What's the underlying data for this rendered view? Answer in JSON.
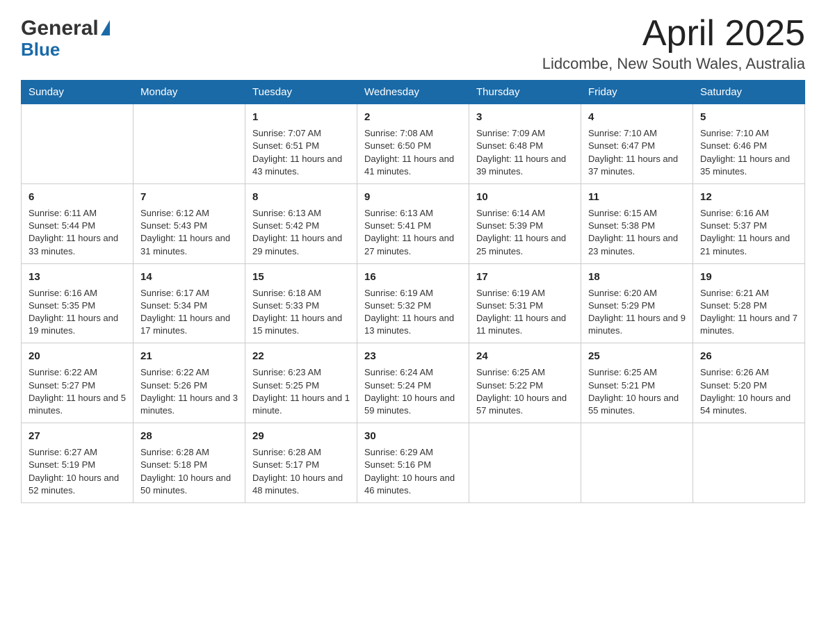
{
  "header": {
    "logo_line1": "General",
    "logo_line2": "Blue",
    "month_year": "April 2025",
    "location": "Lidcombe, New South Wales, Australia"
  },
  "weekdays": [
    "Sunday",
    "Monday",
    "Tuesday",
    "Wednesday",
    "Thursday",
    "Friday",
    "Saturday"
  ],
  "weeks": [
    [
      {
        "day": "",
        "sunrise": "",
        "sunset": "",
        "daylight": ""
      },
      {
        "day": "",
        "sunrise": "",
        "sunset": "",
        "daylight": ""
      },
      {
        "day": "1",
        "sunrise": "Sunrise: 7:07 AM",
        "sunset": "Sunset: 6:51 PM",
        "daylight": "Daylight: 11 hours and 43 minutes."
      },
      {
        "day": "2",
        "sunrise": "Sunrise: 7:08 AM",
        "sunset": "Sunset: 6:50 PM",
        "daylight": "Daylight: 11 hours and 41 minutes."
      },
      {
        "day": "3",
        "sunrise": "Sunrise: 7:09 AM",
        "sunset": "Sunset: 6:48 PM",
        "daylight": "Daylight: 11 hours and 39 minutes."
      },
      {
        "day": "4",
        "sunrise": "Sunrise: 7:10 AM",
        "sunset": "Sunset: 6:47 PM",
        "daylight": "Daylight: 11 hours and 37 minutes."
      },
      {
        "day": "5",
        "sunrise": "Sunrise: 7:10 AM",
        "sunset": "Sunset: 6:46 PM",
        "daylight": "Daylight: 11 hours and 35 minutes."
      }
    ],
    [
      {
        "day": "6",
        "sunrise": "Sunrise: 6:11 AM",
        "sunset": "Sunset: 5:44 PM",
        "daylight": "Daylight: 11 hours and 33 minutes."
      },
      {
        "day": "7",
        "sunrise": "Sunrise: 6:12 AM",
        "sunset": "Sunset: 5:43 PM",
        "daylight": "Daylight: 11 hours and 31 minutes."
      },
      {
        "day": "8",
        "sunrise": "Sunrise: 6:13 AM",
        "sunset": "Sunset: 5:42 PM",
        "daylight": "Daylight: 11 hours and 29 minutes."
      },
      {
        "day": "9",
        "sunrise": "Sunrise: 6:13 AM",
        "sunset": "Sunset: 5:41 PM",
        "daylight": "Daylight: 11 hours and 27 minutes."
      },
      {
        "day": "10",
        "sunrise": "Sunrise: 6:14 AM",
        "sunset": "Sunset: 5:39 PM",
        "daylight": "Daylight: 11 hours and 25 minutes."
      },
      {
        "day": "11",
        "sunrise": "Sunrise: 6:15 AM",
        "sunset": "Sunset: 5:38 PM",
        "daylight": "Daylight: 11 hours and 23 minutes."
      },
      {
        "day": "12",
        "sunrise": "Sunrise: 6:16 AM",
        "sunset": "Sunset: 5:37 PM",
        "daylight": "Daylight: 11 hours and 21 minutes."
      }
    ],
    [
      {
        "day": "13",
        "sunrise": "Sunrise: 6:16 AM",
        "sunset": "Sunset: 5:35 PM",
        "daylight": "Daylight: 11 hours and 19 minutes."
      },
      {
        "day": "14",
        "sunrise": "Sunrise: 6:17 AM",
        "sunset": "Sunset: 5:34 PM",
        "daylight": "Daylight: 11 hours and 17 minutes."
      },
      {
        "day": "15",
        "sunrise": "Sunrise: 6:18 AM",
        "sunset": "Sunset: 5:33 PM",
        "daylight": "Daylight: 11 hours and 15 minutes."
      },
      {
        "day": "16",
        "sunrise": "Sunrise: 6:19 AM",
        "sunset": "Sunset: 5:32 PM",
        "daylight": "Daylight: 11 hours and 13 minutes."
      },
      {
        "day": "17",
        "sunrise": "Sunrise: 6:19 AM",
        "sunset": "Sunset: 5:31 PM",
        "daylight": "Daylight: 11 hours and 11 minutes."
      },
      {
        "day": "18",
        "sunrise": "Sunrise: 6:20 AM",
        "sunset": "Sunset: 5:29 PM",
        "daylight": "Daylight: 11 hours and 9 minutes."
      },
      {
        "day": "19",
        "sunrise": "Sunrise: 6:21 AM",
        "sunset": "Sunset: 5:28 PM",
        "daylight": "Daylight: 11 hours and 7 minutes."
      }
    ],
    [
      {
        "day": "20",
        "sunrise": "Sunrise: 6:22 AM",
        "sunset": "Sunset: 5:27 PM",
        "daylight": "Daylight: 11 hours and 5 minutes."
      },
      {
        "day": "21",
        "sunrise": "Sunrise: 6:22 AM",
        "sunset": "Sunset: 5:26 PM",
        "daylight": "Daylight: 11 hours and 3 minutes."
      },
      {
        "day": "22",
        "sunrise": "Sunrise: 6:23 AM",
        "sunset": "Sunset: 5:25 PM",
        "daylight": "Daylight: 11 hours and 1 minute."
      },
      {
        "day": "23",
        "sunrise": "Sunrise: 6:24 AM",
        "sunset": "Sunset: 5:24 PM",
        "daylight": "Daylight: 10 hours and 59 minutes."
      },
      {
        "day": "24",
        "sunrise": "Sunrise: 6:25 AM",
        "sunset": "Sunset: 5:22 PM",
        "daylight": "Daylight: 10 hours and 57 minutes."
      },
      {
        "day": "25",
        "sunrise": "Sunrise: 6:25 AM",
        "sunset": "Sunset: 5:21 PM",
        "daylight": "Daylight: 10 hours and 55 minutes."
      },
      {
        "day": "26",
        "sunrise": "Sunrise: 6:26 AM",
        "sunset": "Sunset: 5:20 PM",
        "daylight": "Daylight: 10 hours and 54 minutes."
      }
    ],
    [
      {
        "day": "27",
        "sunrise": "Sunrise: 6:27 AM",
        "sunset": "Sunset: 5:19 PM",
        "daylight": "Daylight: 10 hours and 52 minutes."
      },
      {
        "day": "28",
        "sunrise": "Sunrise: 6:28 AM",
        "sunset": "Sunset: 5:18 PM",
        "daylight": "Daylight: 10 hours and 50 minutes."
      },
      {
        "day": "29",
        "sunrise": "Sunrise: 6:28 AM",
        "sunset": "Sunset: 5:17 PM",
        "daylight": "Daylight: 10 hours and 48 minutes."
      },
      {
        "day": "30",
        "sunrise": "Sunrise: 6:29 AM",
        "sunset": "Sunset: 5:16 PM",
        "daylight": "Daylight: 10 hours and 46 minutes."
      },
      {
        "day": "",
        "sunrise": "",
        "sunset": "",
        "daylight": ""
      },
      {
        "day": "",
        "sunrise": "",
        "sunset": "",
        "daylight": ""
      },
      {
        "day": "",
        "sunrise": "",
        "sunset": "",
        "daylight": ""
      }
    ]
  ]
}
